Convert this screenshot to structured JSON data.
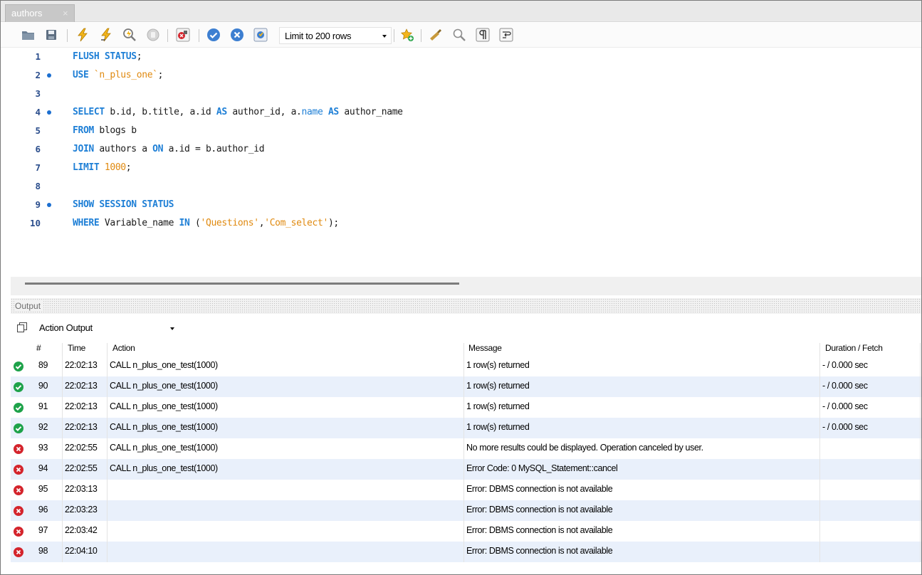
{
  "tab": {
    "title": "authors",
    "close": "×"
  },
  "toolbar": {
    "limit_select": "Limit to 200 rows",
    "icons": [
      "open-folder-icon",
      "save-icon",
      "execute-icon",
      "execute-current-icon",
      "explain-icon",
      "stop-icon",
      "toggle-error-icon",
      "commit-icon",
      "rollback-icon",
      "autocommit-icon",
      "add-snippet-icon",
      "beautify-icon",
      "find-icon",
      "invisible-chars-icon",
      "wrap-icon"
    ]
  },
  "editor": {
    "lines": [
      {
        "n": "1",
        "marker": false
      },
      {
        "n": "2",
        "marker": true
      },
      {
        "n": "3",
        "marker": false
      },
      {
        "n": "4",
        "marker": true
      },
      {
        "n": "5",
        "marker": false
      },
      {
        "n": "6",
        "marker": false
      },
      {
        "n": "7",
        "marker": false
      },
      {
        "n": "8",
        "marker": false
      },
      {
        "n": "9",
        "marker": true
      },
      {
        "n": "10",
        "marker": false
      }
    ],
    "code": {
      "l1_kw": "FLUSH STATUS",
      "l1_rest": ";",
      "l2_kw": "USE",
      "l2_str": "`n_plus_one`",
      "l2_rest": ";",
      "l4_kw": "SELECT",
      "l4_a": " b.id, b.title, a.id ",
      "l4_as1": "AS",
      "l4_b": " author_id, a.",
      "l4_name": "name",
      "l4_c": " ",
      "l4_as2": "AS",
      "l4_d": " author_name",
      "l5_kw": "FROM",
      "l5_rest": " blogs b",
      "l6_kw": "JOIN",
      "l6_a": " authors a ",
      "l6_on": "ON",
      "l6_b": " a.id = b.author_id",
      "l7_kw": "LIMIT",
      "l7_num": "1000",
      "l7_rest": ";",
      "l9_kw": "SHOW SESSION STATUS",
      "l10_kw": "WHERE",
      "l10_a": " Variable_name ",
      "l10_in": "IN",
      "l10_b": " (",
      "l10_s1": "'Questions'",
      "l10_c": ",",
      "l10_s2": "'Com_select'",
      "l10_d": ");"
    }
  },
  "output": {
    "label": "Output",
    "selector": "Action Output",
    "columns": {
      "num": "#",
      "time": "Time",
      "action": "Action",
      "message": "Message",
      "duration": "Duration / Fetch"
    },
    "rows": [
      {
        "status": "ok",
        "num": "89",
        "time": "22:02:13",
        "action": "CALL n_plus_one_test(1000)",
        "message": "1 row(s) returned",
        "duration": "- / 0.000 sec"
      },
      {
        "status": "ok",
        "num": "90",
        "time": "22:02:13",
        "action": "CALL n_plus_one_test(1000)",
        "message": "1 row(s) returned",
        "duration": "- / 0.000 sec"
      },
      {
        "status": "ok",
        "num": "91",
        "time": "22:02:13",
        "action": "CALL n_plus_one_test(1000)",
        "message": "1 row(s) returned",
        "duration": "- / 0.000 sec"
      },
      {
        "status": "ok",
        "num": "92",
        "time": "22:02:13",
        "action": "CALL n_plus_one_test(1000)",
        "message": "1 row(s) returned",
        "duration": "- / 0.000 sec"
      },
      {
        "status": "err",
        "num": "93",
        "time": "22:02:55",
        "action": "CALL n_plus_one_test(1000)",
        "message": "No more results could be displayed. Operation canceled by user.",
        "duration": ""
      },
      {
        "status": "err",
        "num": "94",
        "time": "22:02:55",
        "action": "CALL n_plus_one_test(1000)",
        "message": "Error Code: 0 MySQL_Statement::cancel",
        "duration": ""
      },
      {
        "status": "err",
        "num": "95",
        "time": "22:03:13",
        "action": "",
        "message": "Error: DBMS connection is not available",
        "duration": ""
      },
      {
        "status": "err",
        "num": "96",
        "time": "22:03:23",
        "action": "",
        "message": "Error: DBMS connection is not available",
        "duration": ""
      },
      {
        "status": "err",
        "num": "97",
        "time": "22:03:42",
        "action": "",
        "message": "Error: DBMS connection is not available",
        "duration": ""
      },
      {
        "status": "err",
        "num": "98",
        "time": "22:04:10",
        "action": "",
        "message": "Error: DBMS connection is not available",
        "duration": ""
      }
    ]
  },
  "colors": {
    "keyword": "#1e7fd6",
    "string": "#e08a10",
    "ok": "#1ea24a",
    "error": "#d4242c",
    "alt_row": "#e9f0fb"
  }
}
